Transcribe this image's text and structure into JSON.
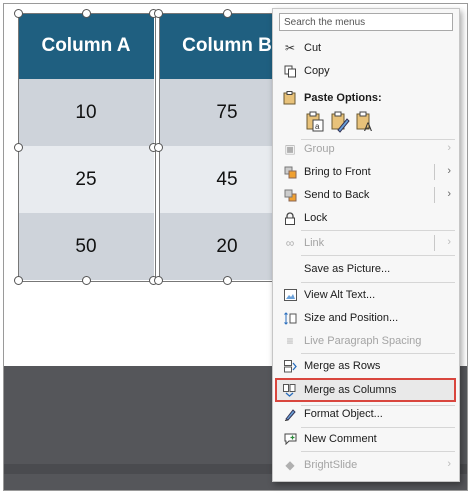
{
  "table": {
    "col_a_header": "Column A",
    "col_b_header": "Column B",
    "col_a_values": [
      "10",
      "25",
      "50"
    ],
    "col_b_values": [
      "75",
      "45",
      "20"
    ]
  },
  "menu": {
    "search_placeholder": "Search the menus",
    "cut": "Cut",
    "copy": "Copy",
    "paste_options": "Paste Options:",
    "group": "Group",
    "bring_to_front": "Bring to Front",
    "send_to_back": "Send to Back",
    "lock": "Lock",
    "link": "Link",
    "save_as_picture": "Save as Picture...",
    "view_alt_text": "View Alt Text...",
    "size_position": "Size and Position...",
    "live_paragraph": "Live Paragraph Spacing",
    "merge_rows": "Merge as Rows",
    "merge_columns": "Merge as Columns",
    "format_object": "Format Object...",
    "new_comment": "New Comment",
    "brightslide": "BrightSlide"
  },
  "colors": {
    "header": "#1f5f80",
    "highlight_border": "#d9463e"
  }
}
